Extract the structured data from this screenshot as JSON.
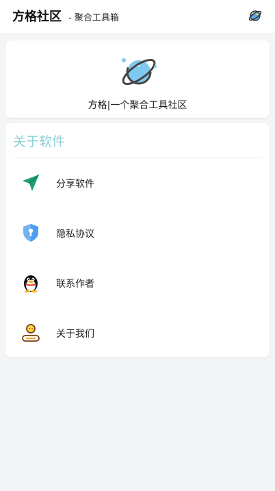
{
  "header": {
    "title": "方格社区",
    "subtitle": "- 聚合工具箱",
    "planet_icon": "planet-icon"
  },
  "intro": {
    "logo_icon": "planet-logo-icon",
    "slogan": "方格|一个聚合工具社区"
  },
  "about": {
    "title": "关于软件",
    "items": [
      {
        "label": "分享软件",
        "icon": "send-icon"
      },
      {
        "label": "隐私协议",
        "icon": "shield-lock-icon"
      },
      {
        "label": "联系作者",
        "icon": "qq-penguin-icon"
      },
      {
        "label": "关于我们",
        "icon": "user-badge-icon"
      }
    ]
  },
  "colors": {
    "accent": "#8dd0d2",
    "share_green": "#1f9e72",
    "shield_blue": "#4d9ef0"
  }
}
